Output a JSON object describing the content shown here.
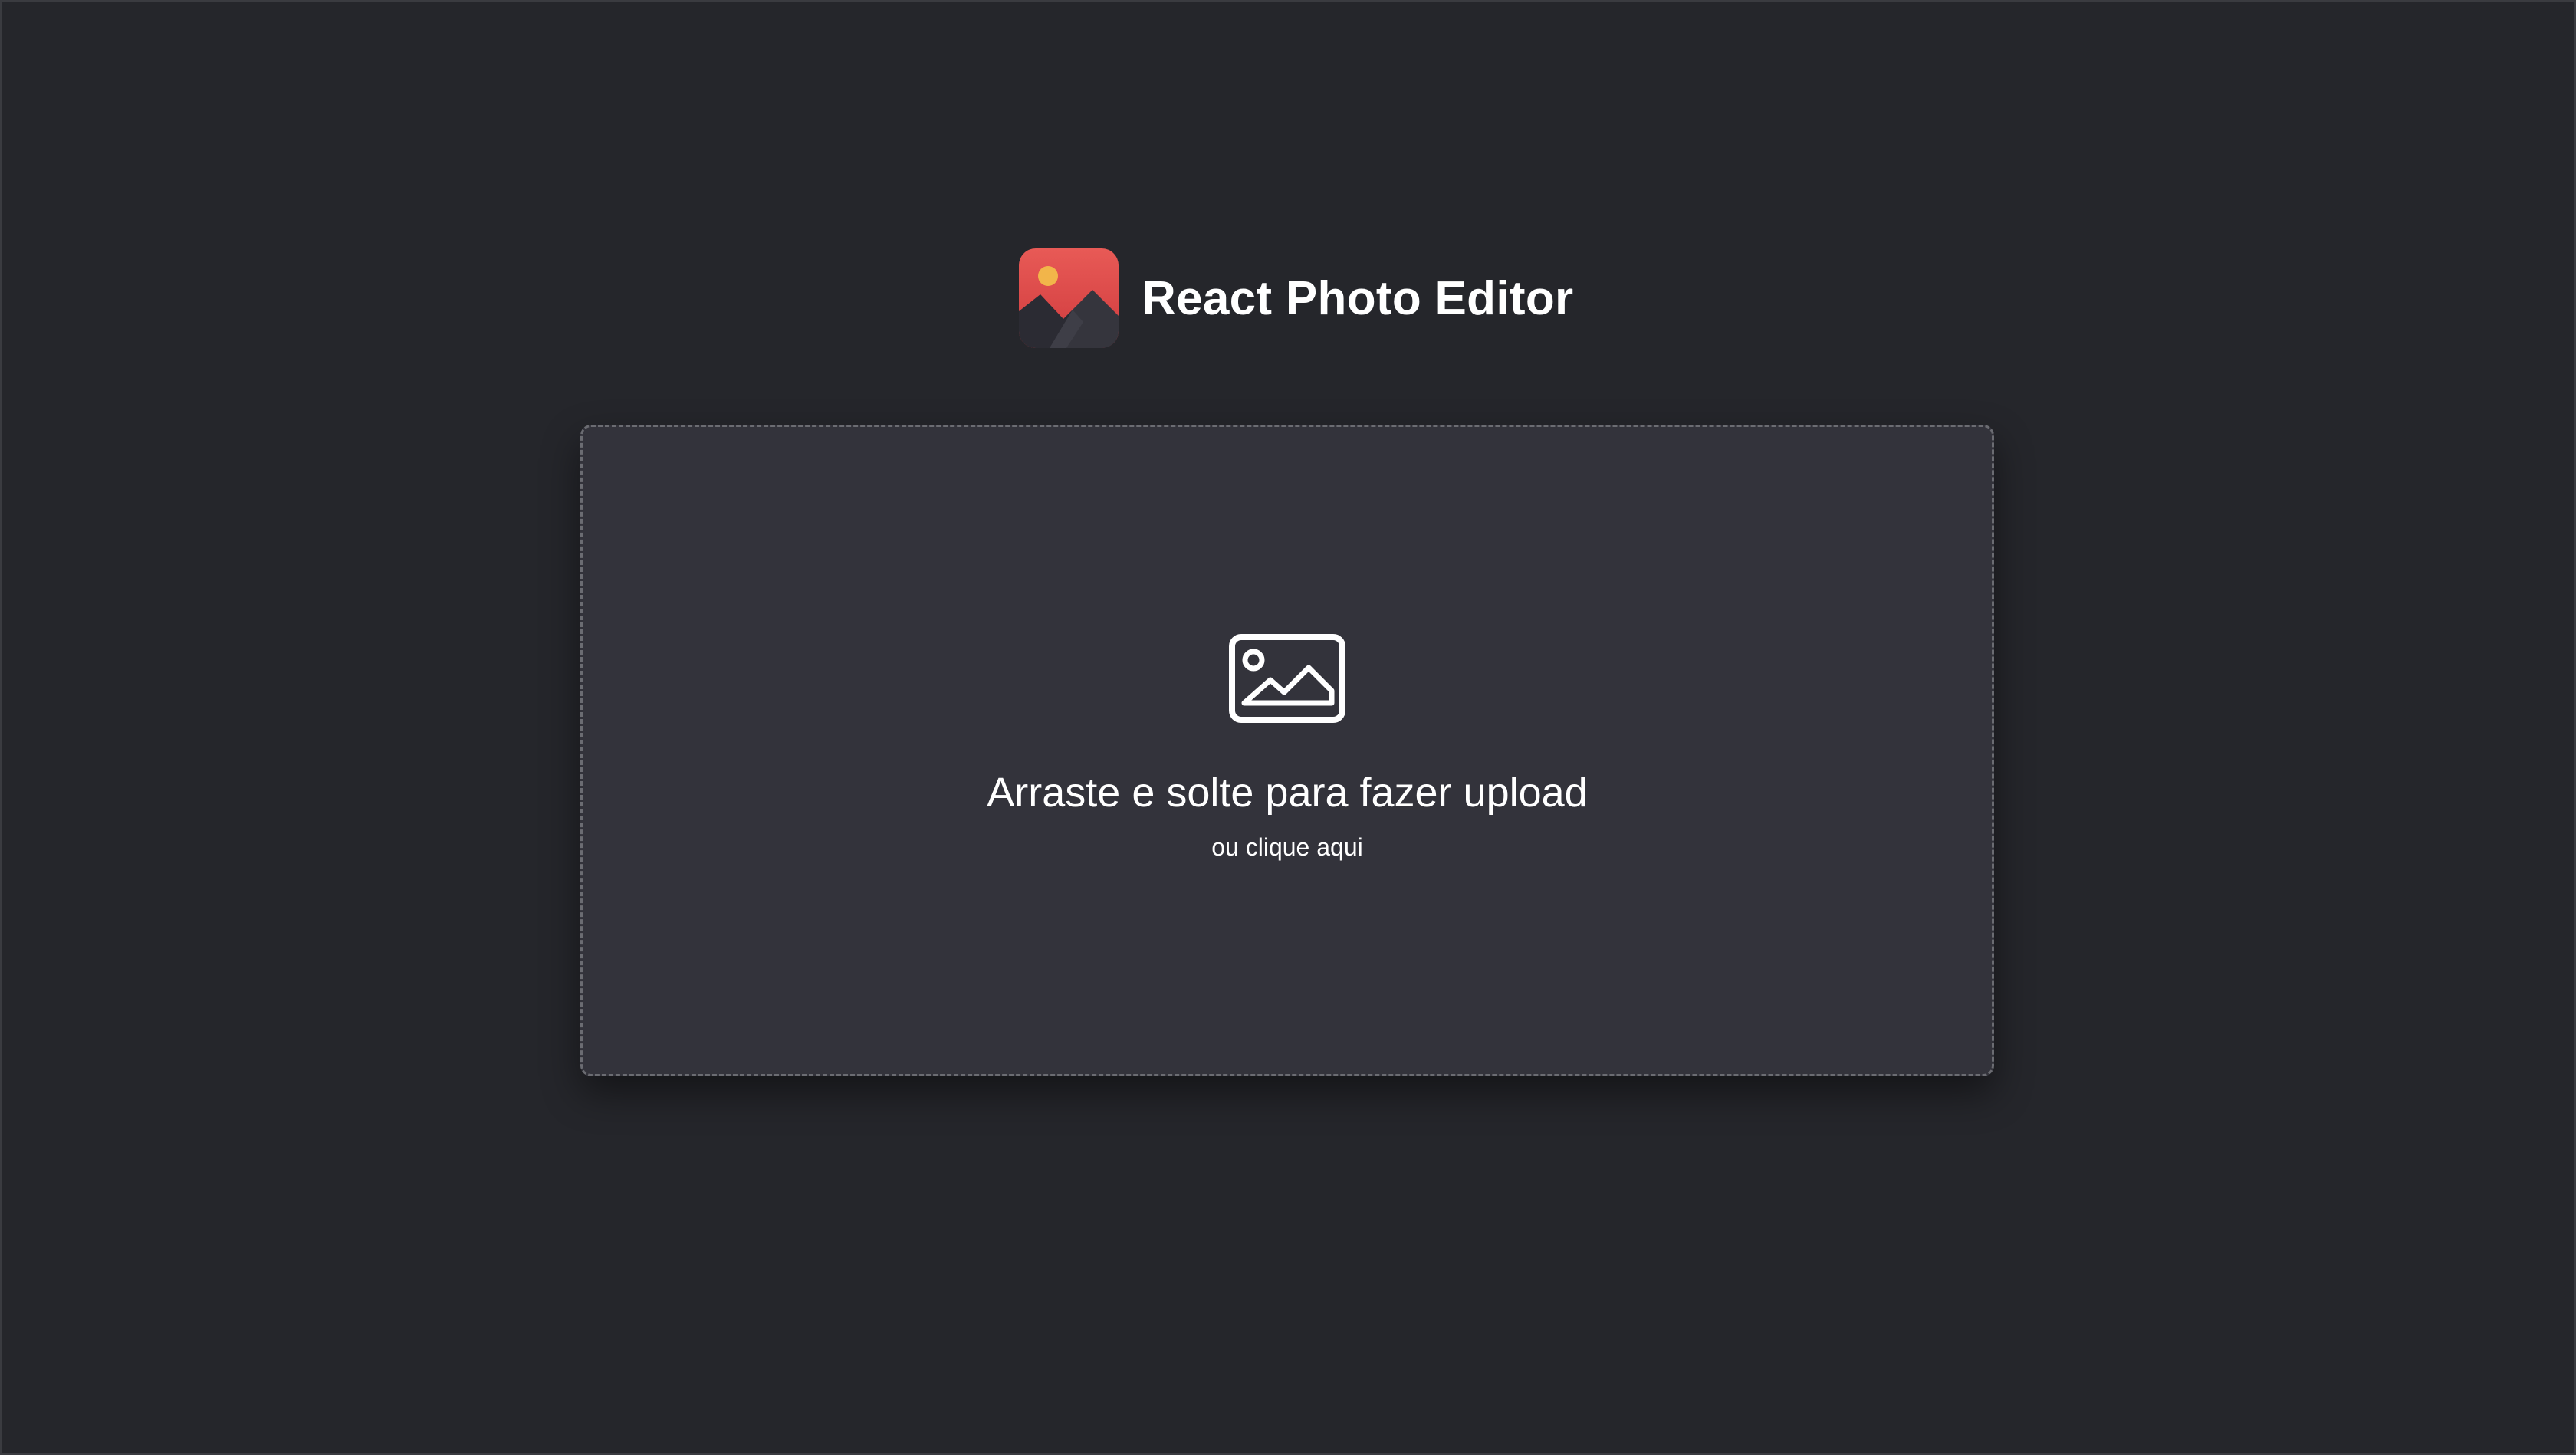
{
  "app": {
    "title": "React Photo Editor",
    "logo_icon": "mountain-sun-logo-icon"
  },
  "dropzone": {
    "icon": "image-icon",
    "title": "Arraste e solte para fazer upload",
    "subtitle": "ou clique aqui"
  },
  "colors": {
    "background": "#25262b",
    "dropzone_background": "#33333b",
    "dropzone_border": "#6b6c72",
    "logo_red": "#e04a4a",
    "logo_sun": "#f2b54a",
    "text": "#ffffff"
  }
}
